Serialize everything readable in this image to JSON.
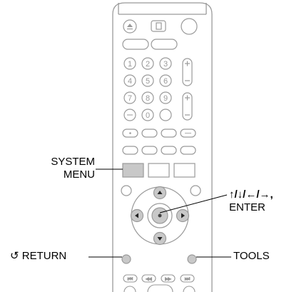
{
  "callouts": {
    "system_menu_line1": "SYSTEM",
    "system_menu_line2": "MENU",
    "arrows_line1": "↑/↓/←/→,",
    "arrows_line2": "ENTER",
    "return": "↺ RETURN",
    "tools": "TOOLS"
  },
  "keypad_labels": [
    "1",
    "2",
    "3",
    "4",
    "5",
    "6",
    "7",
    "8",
    "9",
    "0"
  ],
  "colors": {
    "outline": "#9a9a9a",
    "highlight": "#c8c8c8",
    "leader_line": "#000000"
  }
}
